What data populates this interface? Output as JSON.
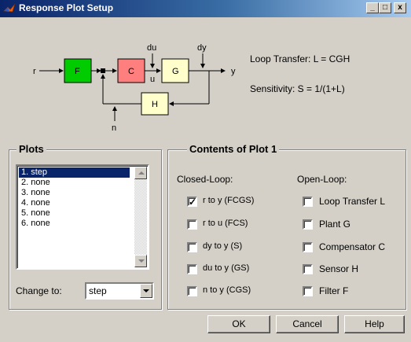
{
  "window": {
    "title": "Response Plot Setup",
    "min": "_",
    "max": "□",
    "close": "x"
  },
  "diagram": {
    "r": "r",
    "F": "F",
    "C": "C",
    "G": "G",
    "H": "H",
    "du": "du",
    "dy": "dy",
    "u": "u",
    "y": "y",
    "n": "n",
    "loop_transfer": "Loop Transfer: L = CGH",
    "sensitivity": "Sensitivity:  S = 1/(1+L)",
    "colors": {
      "F": "#00cc00",
      "C": "#ff7f7f",
      "G": "#ffffcc",
      "H": "#ffffcc"
    }
  },
  "plots": {
    "title": "Plots",
    "items": [
      "1. step",
      "2. none",
      "3. none",
      "4. none",
      "5. none",
      "6. none"
    ],
    "selected_index": 0,
    "change_to_label": "Change to:",
    "change_to_value": "step"
  },
  "contents": {
    "title": "Contents of Plot 1",
    "closed_loop_header": "Closed-Loop:",
    "open_loop_header": "Open-Loop:",
    "closed_loop": [
      {
        "label": "r to y  (FCGS)",
        "checked": true
      },
      {
        "label": "r to u  (FCS)",
        "checked": false
      },
      {
        "label": "dy to y  (S)",
        "checked": false
      },
      {
        "label": "du to y  (GS)",
        "checked": false
      },
      {
        "label": "n to y  (CGS)",
        "checked": false
      }
    ],
    "open_loop": [
      {
        "label": "Loop Transfer L",
        "checked": false
      },
      {
        "label": "Plant G",
        "checked": false
      },
      {
        "label": "Compensator C",
        "checked": false
      },
      {
        "label": "Sensor H",
        "checked": false
      },
      {
        "label": "Filter F",
        "checked": false
      }
    ],
    "check_mark": "✓"
  },
  "buttons": {
    "ok": "OK",
    "cancel": "Cancel",
    "help": "Help"
  }
}
